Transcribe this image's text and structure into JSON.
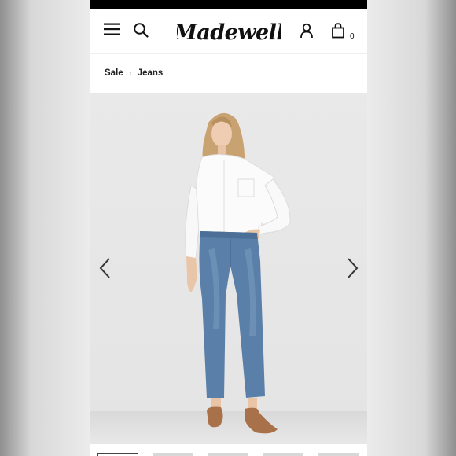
{
  "header": {
    "brand": "Madewell",
    "cart_count": "0",
    "icons": {
      "menu": "hamburger-menu-icon",
      "search": "search-icon",
      "account": "account-icon",
      "cart": "shopping-bag-icon"
    }
  },
  "breadcrumb": {
    "items": [
      {
        "label": "Sale"
      },
      {
        "label": "Jeans"
      }
    ],
    "separator_icon": "chevron-right-icon"
  },
  "gallery": {
    "prev_icon": "chevron-left-icon",
    "next_icon": "chevron-right-icon",
    "thumbnail_count": 5,
    "active_thumbnail": 1
  },
  "colors": {
    "header_bg": "#ffffff",
    "status_bar": "#000000",
    "text": "#222222",
    "hero_bg": "#e8e8e8",
    "denim": "#5a7fa8"
  }
}
